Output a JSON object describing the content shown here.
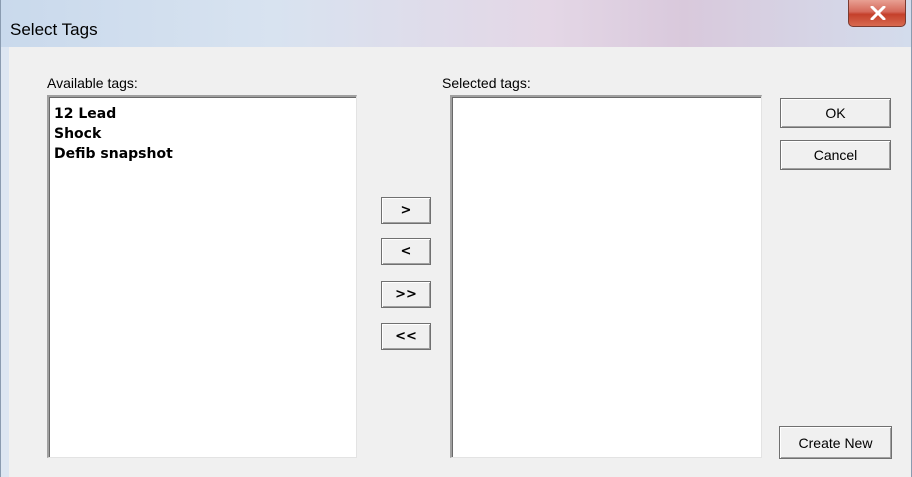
{
  "window": {
    "title": "Select Tags"
  },
  "available": {
    "label": "Available tags:",
    "items": [
      "12 Lead",
      "Shock",
      "Defib snapshot"
    ]
  },
  "selected": {
    "label": "Selected tags:",
    "items": []
  },
  "transfer": {
    "add_label": ">",
    "remove_label": "<",
    "add_all_label": ">>",
    "remove_all_label": "<<"
  },
  "actions": {
    "ok_label": "OK",
    "cancel_label": "Cancel",
    "create_new_label": "Create New"
  },
  "icons": {
    "close": "close-icon"
  },
  "colors": {
    "dialog_bg": "#f0f0f0",
    "close_button": "#c4402b",
    "listbox_bg": "#ffffff"
  }
}
